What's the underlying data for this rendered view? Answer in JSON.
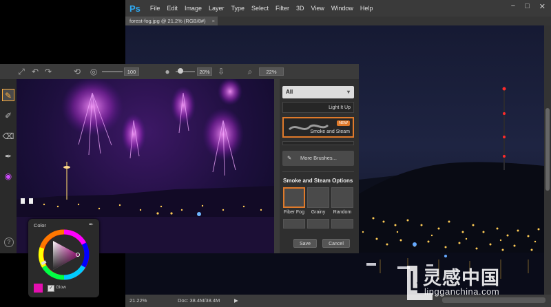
{
  "photoshop": {
    "logo": "Ps",
    "menu": [
      "File",
      "Edit",
      "Image",
      "Layer",
      "Type",
      "Select",
      "Filter",
      "3D",
      "View",
      "Window",
      "Help"
    ],
    "window_controls": {
      "minimize": "−",
      "maximize": "□",
      "close": "✕"
    },
    "document_tab": {
      "title": "forest-fog.jpg @ 21.2% (RGB/8#)",
      "close": "×"
    },
    "status": {
      "zoom": "21.22%",
      "doc": "Doc: 38.4M/38.4M",
      "arrow": "▶"
    }
  },
  "plugin": {
    "toolbar": {
      "opacity_value": "100",
      "flow_value": "20%",
      "zoom_value": "22%"
    },
    "tools": [
      {
        "name": "brush-tool",
        "glyph": "✎",
        "active": true
      },
      {
        "name": "smudge-tool",
        "glyph": "✐",
        "active": false
      },
      {
        "name": "eraser-tool",
        "glyph": "⌫",
        "active": false
      },
      {
        "name": "eyedropper-tool",
        "glyph": "✒",
        "active": false
      },
      {
        "name": "color-wheel-tool",
        "glyph": "◉",
        "active": false
      }
    ],
    "help": "?",
    "brushes": {
      "filter": "All",
      "items": [
        "Light It Up",
        "Smoke and Steam"
      ],
      "new_badge": "NEW",
      "more_button": "More Brushes..."
    },
    "options": {
      "title": "Smoke and Steam Options",
      "thumbs": [
        "Fiber Fog",
        "Grainy",
        "Random"
      ],
      "save": "Save",
      "cancel": "Cancel"
    }
  },
  "color_panel": {
    "title": "Color",
    "current_color": "#e40fb0",
    "glow_label": "Glow",
    "glow_checked": "✓"
  },
  "watermark": {
    "text": "灵感中国",
    "url": "lingganchina.com"
  }
}
